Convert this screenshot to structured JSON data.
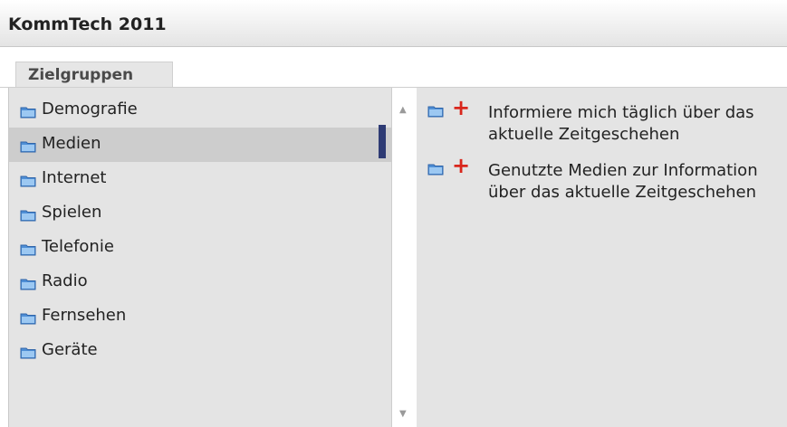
{
  "header": {
    "title": "KommTech 2011"
  },
  "tabs": [
    {
      "label": "Zielgruppen",
      "active": true
    }
  ],
  "categories": {
    "selected_index": 1,
    "items": [
      {
        "label": "Demografie",
        "icon": "folder-icon"
      },
      {
        "label": "Medien",
        "icon": "folder-icon"
      },
      {
        "label": "Internet",
        "icon": "folder-icon"
      },
      {
        "label": "Spielen",
        "icon": "folder-icon"
      },
      {
        "label": "Telefonie",
        "icon": "folder-icon"
      },
      {
        "label": "Radio",
        "icon": "folder-icon"
      },
      {
        "label": "Fernsehen",
        "icon": "folder-icon"
      },
      {
        "label": "Geräte",
        "icon": "folder-icon"
      }
    ]
  },
  "variables": {
    "items": [
      {
        "label": "Informiere mich täglich über das aktuelle Zeitgeschehen",
        "icon": "folder-icon",
        "action_icon": "add-icon"
      },
      {
        "label": "Genutzte Medien zur Information über das aktuelle Zeitgeschehen",
        "icon": "folder-icon",
        "action_icon": "add-icon"
      }
    ]
  },
  "colors": {
    "accent": "#2e3b74",
    "add": "#d9261c",
    "folder": "#4f8fd6",
    "panel": "#e4e4e4",
    "selected": "#cdcdcd"
  }
}
